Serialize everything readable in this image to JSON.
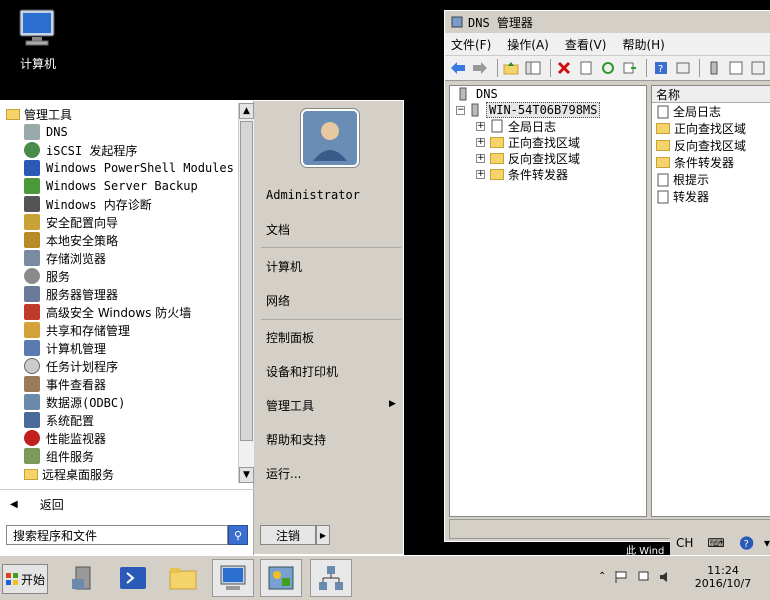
{
  "desktop": {
    "computer_icon_label": "计算机"
  },
  "dns_window": {
    "title": "DNS 管理器",
    "menu": [
      "文件(F)",
      "操作(A)",
      "查看(V)",
      "帮助(H)"
    ],
    "tree": {
      "root": "DNS",
      "server": "WIN-54T06B798MS",
      "children": [
        "全局日志",
        "正向查找区域",
        "反向查找区域",
        "条件转发器"
      ]
    },
    "list_header": "名称",
    "list_items": [
      "全局日志",
      "正向查找区域",
      "反向查找区域",
      "条件转发器",
      "根提示",
      "转发器"
    ]
  },
  "start_menu": {
    "folder": "管理工具",
    "programs": [
      "DNS",
      "iSCSI 发起程序",
      "Windows PowerShell Modules",
      "Windows Server Backup",
      "Windows 内存诊断",
      "安全配置向导",
      "本地安全策略",
      "存储浏览器",
      "服务",
      "服务器管理器",
      "高级安全 Windows 防火墙",
      "共享和存储管理",
      "计算机管理",
      "任务计划程序",
      "事件查看器",
      "数据源(ODBC)",
      "系统配置",
      "性能监视器",
      "组件服务",
      "远程桌面服务"
    ],
    "back_label": "返回",
    "search_placeholder": "搜索程序和文件",
    "user": "Administrator",
    "right_items": [
      "文档",
      "计算机",
      "网络",
      "控制面板",
      "设备和打印机",
      "管理工具",
      "帮助和支持",
      "运行..."
    ],
    "logoff_label": "注销"
  },
  "taskbar": {
    "start_label": "开始",
    "clock_time": "11:24",
    "clock_date": "2016/10/7",
    "lang": "CH",
    "win_text": "此 Wind"
  }
}
